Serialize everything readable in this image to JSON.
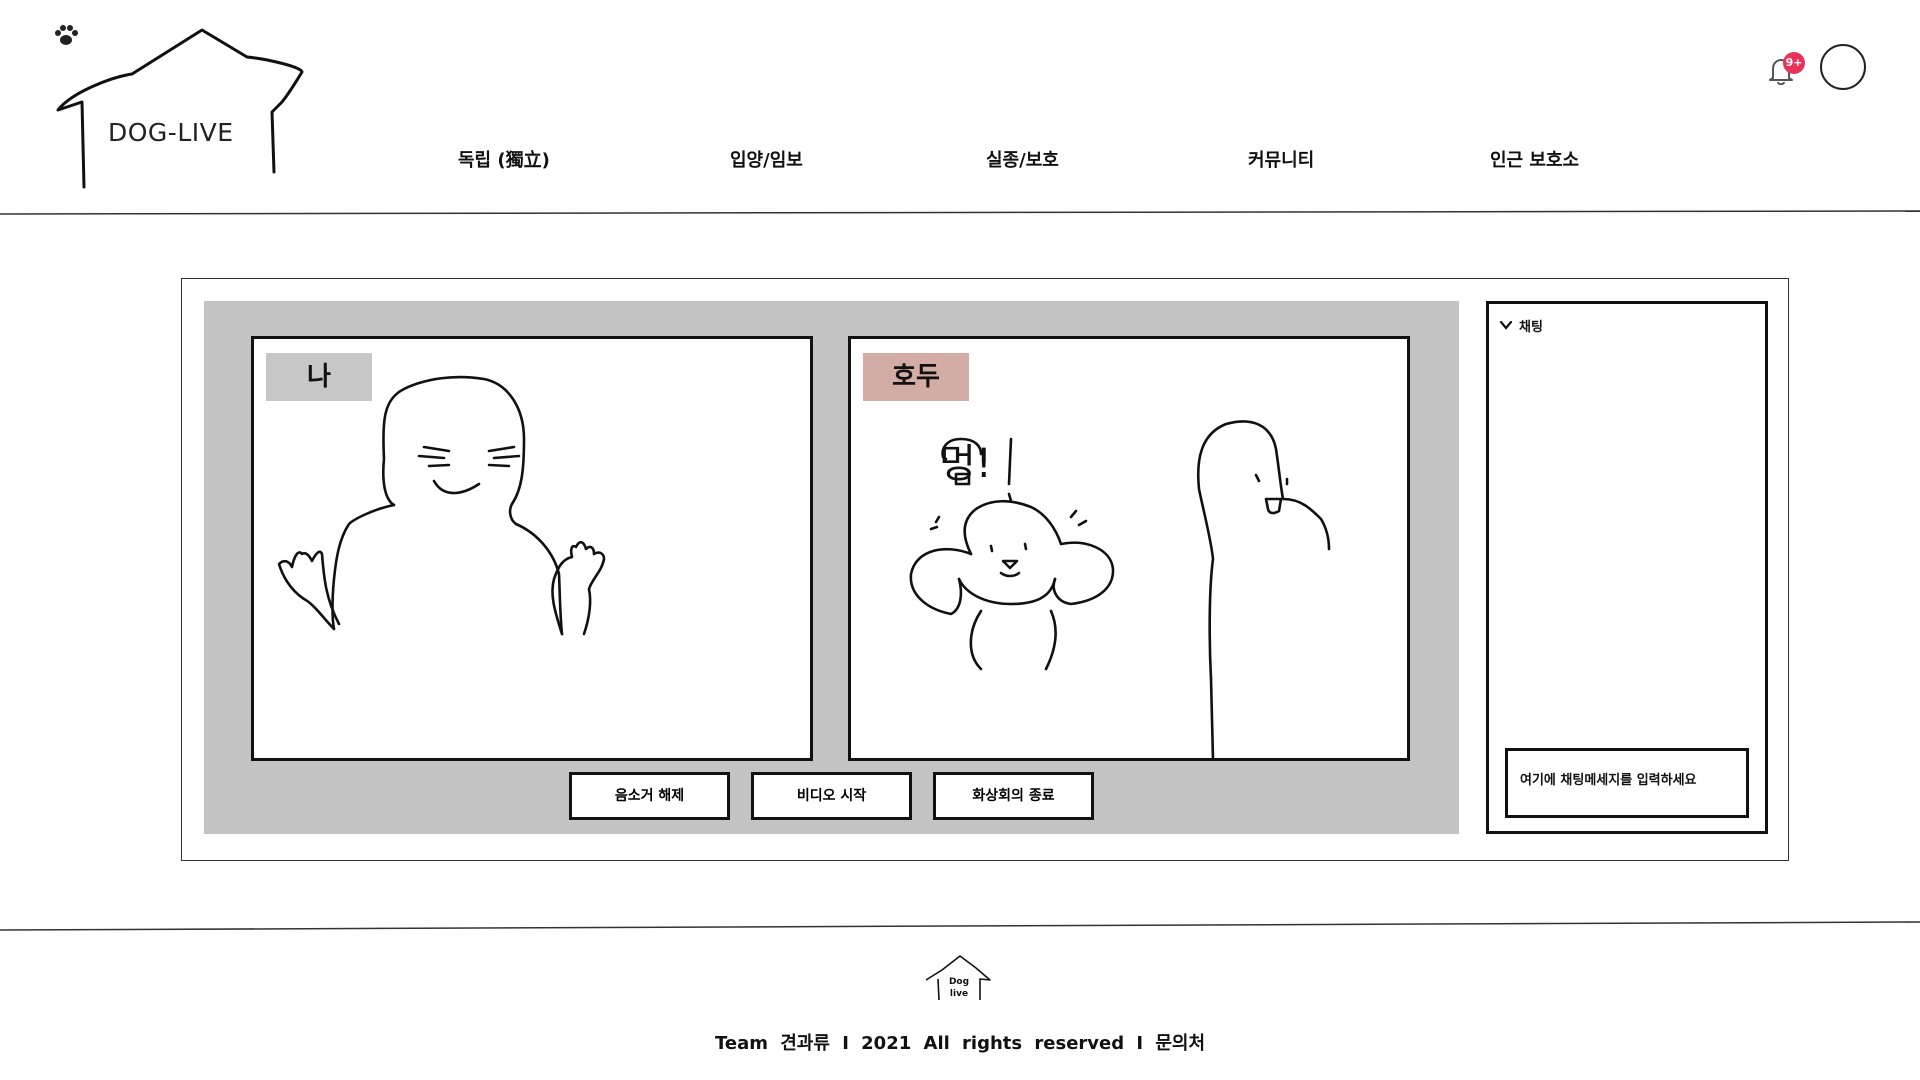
{
  "header": {
    "logo_text": "DOG-LIVE",
    "nav": [
      "독립 (獨立)",
      "입양/임보",
      "실종/보호",
      "커뮤니티",
      "인근 보호소"
    ],
    "notification_badge": "9+",
    "badge_color": "#e8325a"
  },
  "conference": {
    "participants": [
      {
        "name": "나",
        "tag_color": "#c7c7c7"
      },
      {
        "name": "호두",
        "tag_color": "#d3ada5"
      }
    ],
    "bubble_text": "멍!",
    "controls": [
      "음소거 해제",
      "비디오 시작",
      "화상회의 종료"
    ]
  },
  "chat": {
    "title": "채팅",
    "input_placeholder": "여기에 채팅메세지를 입력하세요"
  },
  "footer": {
    "logo_text_1": "Dog",
    "logo_text_2": "live",
    "text": "Team 견과류 I 2021 All rights reserved I 문의처"
  },
  "icons": [
    "house-logo-icon",
    "paw-icon",
    "bell-icon",
    "chevron-down-icon"
  ]
}
